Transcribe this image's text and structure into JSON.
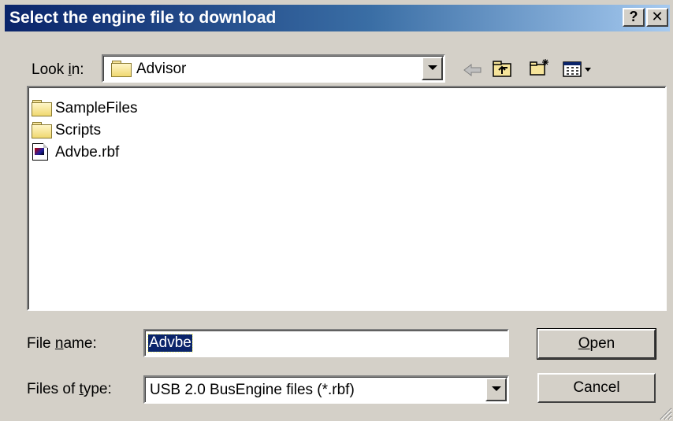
{
  "window": {
    "title": "Select the engine file to download",
    "help_label": "?",
    "close_label": "✕"
  },
  "look_in": {
    "label_prefix": "Look ",
    "label_accel": "i",
    "label_suffix": "n:",
    "value": "Advisor",
    "icon": "open-folder-icon"
  },
  "toolbar": {
    "icons": [
      "back-arrow-icon",
      "up-one-level-icon",
      "new-folder-icon",
      "view-menu-icon"
    ]
  },
  "file_list": {
    "items": [
      {
        "name": "SampleFiles",
        "icon": "folder-icon"
      },
      {
        "name": "Scripts",
        "icon": "folder-icon"
      },
      {
        "name": "Advbe.rbf",
        "icon": "rbf-file-icon"
      }
    ]
  },
  "file_name": {
    "label_prefix": "File ",
    "label_accel": "n",
    "label_suffix": "ame:",
    "value": "Advbe"
  },
  "file_type": {
    "label_prefix": "Files of ",
    "label_accel": "t",
    "label_suffix": "ype:",
    "value": "USB 2.0 BusEngine files (*.rbf)"
  },
  "buttons": {
    "open_accel": "O",
    "open_rest": "pen",
    "cancel": "Cancel"
  },
  "colors": {
    "title_gradient_start": "#0a246a",
    "title_gradient_end": "#a6caf0",
    "dialog_face": "#d4d0c8",
    "selection": "#0a246a"
  }
}
